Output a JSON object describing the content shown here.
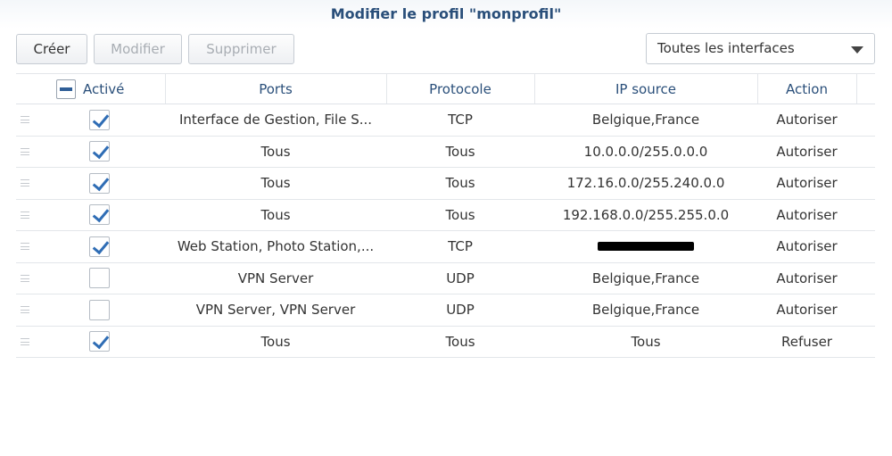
{
  "dialog": {
    "title": "Modifier le profil \"monprofil\""
  },
  "toolbar": {
    "create_label": "Créer",
    "modify_label": "Modifier",
    "delete_label": "Supprimer",
    "interface_filter": "Toutes les interfaces"
  },
  "table": {
    "headers": {
      "enabled": "Activé",
      "ports": "Ports",
      "protocol": "Protocole",
      "source_ip": "IP source",
      "action": "Action"
    },
    "rows": [
      {
        "enabled": true,
        "ports": "Interface de Gestion, File S...",
        "protocol": "TCP",
        "source_ip": "Belgique,France",
        "action": "Autoriser"
      },
      {
        "enabled": true,
        "ports": "Tous",
        "protocol": "Tous",
        "source_ip": "10.0.0.0/255.0.0.0",
        "action": "Autoriser"
      },
      {
        "enabled": true,
        "ports": "Tous",
        "protocol": "Tous",
        "source_ip": "172.16.0.0/255.240.0.0",
        "action": "Autoriser"
      },
      {
        "enabled": true,
        "ports": "Tous",
        "protocol": "Tous",
        "source_ip": "192.168.0.0/255.255.0.0",
        "action": "Autoriser"
      },
      {
        "enabled": true,
        "ports": "Web Station, Photo Station,...",
        "protocol": "TCP",
        "source_ip": "",
        "source_ip_redacted": true,
        "action": "Autoriser"
      },
      {
        "enabled": false,
        "ports": "VPN Server",
        "protocol": "UDP",
        "source_ip": "Belgique,France",
        "action": "Autoriser"
      },
      {
        "enabled": false,
        "ports": "VPN Server, VPN Server",
        "protocol": "UDP",
        "source_ip": "Belgique,France",
        "action": "Autoriser"
      },
      {
        "enabled": true,
        "ports": "Tous",
        "protocol": "Tous",
        "source_ip": "Tous",
        "action": "Refuser"
      }
    ]
  },
  "icons": {
    "drag": "drag-handle-icon",
    "checkbox": "checkmark-icon",
    "dropdown": "chevron-down-icon"
  },
  "colors": {
    "title": "#2a4f7a",
    "check": "#2f6db5",
    "disabled_text": "#a8adb3"
  }
}
